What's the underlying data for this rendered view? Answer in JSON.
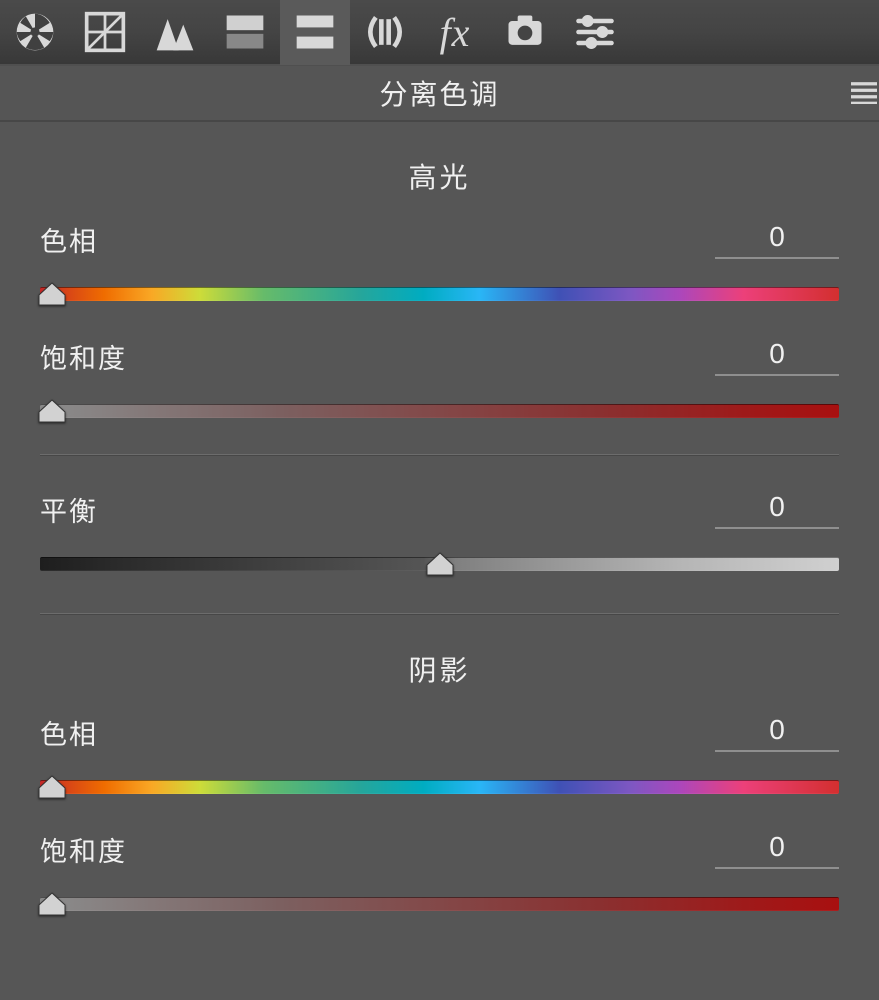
{
  "panel": {
    "title": "分离色调"
  },
  "sections": {
    "highlights": {
      "title": "高光",
      "hue": {
        "label": "色相",
        "value": "0"
      },
      "saturation": {
        "label": "饱和度",
        "value": "0"
      }
    },
    "balance": {
      "label": "平衡",
      "value": "0"
    },
    "shadows": {
      "title": "阴影",
      "hue": {
        "label": "色相",
        "value": "0"
      },
      "saturation": {
        "label": "饱和度",
        "value": "0"
      }
    }
  }
}
